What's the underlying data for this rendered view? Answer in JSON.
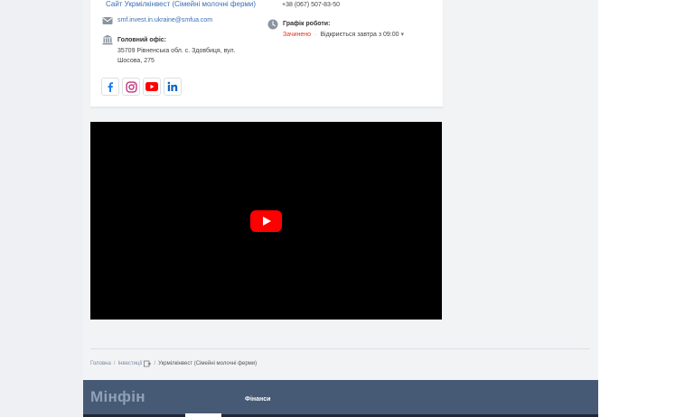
{
  "contacts": {
    "site_link": "Сайт Укрмілкінвест (Сімейні молочні ферми)",
    "email": "smf.invest.in.ukraine@smfua.com",
    "office_label": "Головний офіс:",
    "office_address_line1": "35709 Рівненська обл. с. Здовбиця, вул.",
    "office_address_line2": "Шосова, 275",
    "phone": "+38 (067) 507-83-50",
    "schedule_label": "Графік роботи:",
    "schedule_status": "Зачинено",
    "schedule_dot": "·",
    "schedule_next": "Відкриється завтра з 09:00",
    "schedule_caret": "▾"
  },
  "social": [
    {
      "name": "facebook",
      "icon": "facebook-icon",
      "color": "#1877f2"
    },
    {
      "name": "instagram",
      "icon": "instagram-icon",
      "color": "#c13584"
    },
    {
      "name": "youtube",
      "icon": "youtube-icon",
      "color": "#ff0000"
    },
    {
      "name": "linkedin",
      "icon": "linkedin-icon",
      "color": "#0a66c2"
    }
  ],
  "video": {
    "play_icon": "youtube-play-icon",
    "play_color": "#ff0000"
  },
  "breadcrumb": {
    "home": "Головна",
    "sep": "/",
    "section": "Інвестиції",
    "current": "Укрмілкінвест (Сімейні молочні ферми)"
  },
  "footer": {
    "logo": "Мінфін",
    "link": "Фінанси",
    "bg_color": "#475a75"
  }
}
